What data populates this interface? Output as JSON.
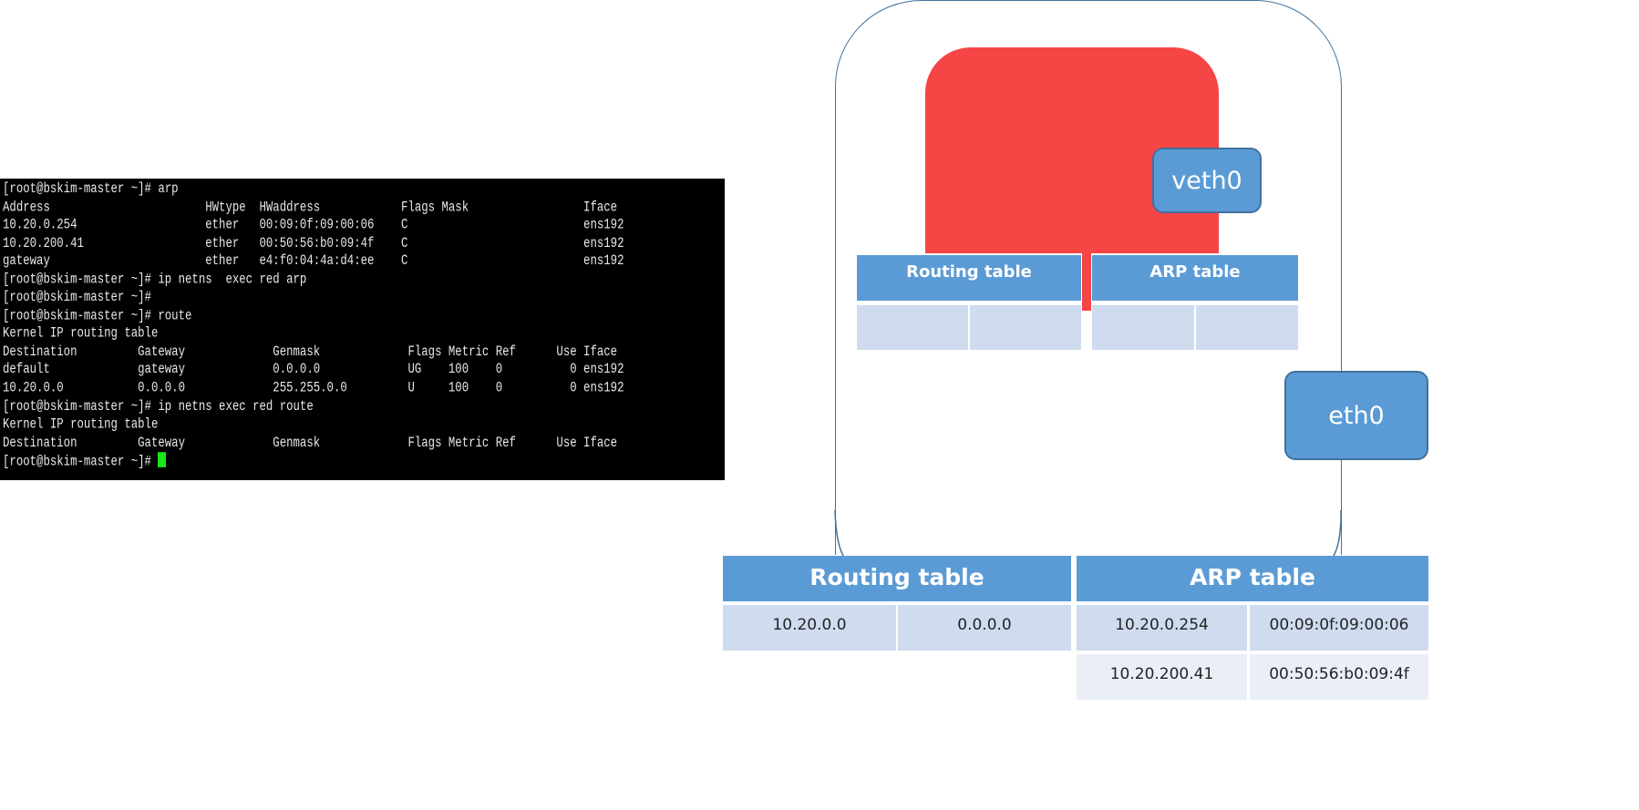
{
  "terminal": {
    "lines": [
      "[root@bskim-master ~]# arp",
      "Address                       HWtype  HWaddress            Flags Mask                 Iface",
      "10.20.0.254                   ether   00:09:0f:09:00:06    C                          ens192",
      "10.20.200.41                  ether   00:50:56:b0:09:4f    C                          ens192",
      "gateway                       ether   e4:f0:04:4a:d4:ee    C                          ens192",
      "[root@bskim-master ~]# ip netns  exec red arp",
      "[root@bskim-master ~]#",
      "[root@bskim-master ~]# route",
      "Kernel IP routing table",
      "Destination         Gateway             Genmask             Flags Metric Ref      Use Iface",
      "default             gateway             0.0.0.0             UG    100    0          0 ens192",
      "10.20.0.0           0.0.0.0             255.255.0.0         U     100    0          0 ens192",
      "[root@bskim-master ~]# ip netns exec red route",
      "Kernel IP routing table",
      "Destination         Gateway             Genmask             Flags Metric Ref      Use Iface",
      "[root@bskim-master ~]# "
    ],
    "cursor_color": "#19e619"
  },
  "diagram": {
    "namespace_color": "#F64545",
    "interface_color": "#5B9BD5",
    "veth_label": "veth0",
    "eth_label": "eth0",
    "ns_routing_title": "Routing table",
    "ns_arp_title": "ARP table",
    "host_routing": {
      "title": "Routing table",
      "rows": [
        [
          "10.20.0.0",
          "0.0.0.0"
        ]
      ]
    },
    "host_arp": {
      "title": "ARP table",
      "rows": [
        [
          "10.20.0.254",
          "00:09:0f:09:00:06"
        ],
        [
          "10.20.200.41",
          "00:50:56:b0:09:4f"
        ]
      ]
    }
  }
}
